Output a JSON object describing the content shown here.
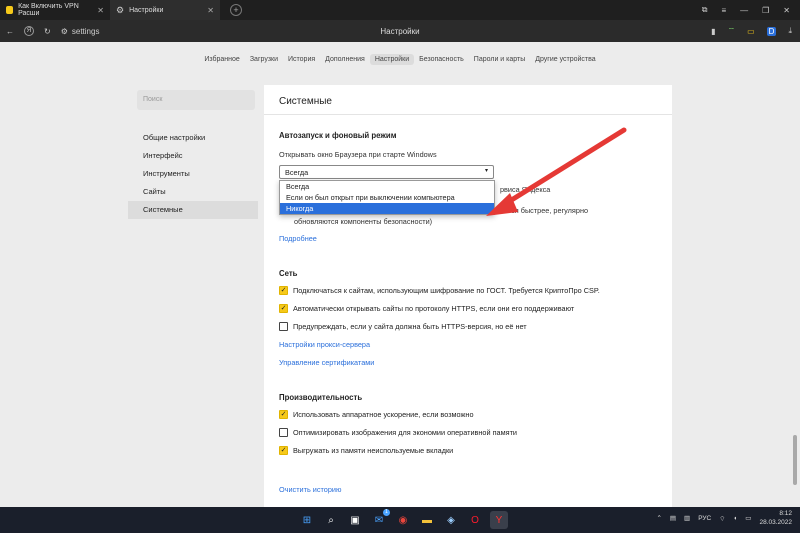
{
  "tabs": [
    {
      "title": "Как Включить VPN Расши",
      "fav_color": "#f6c91a"
    },
    {
      "title": "Настройки",
      "fav_color": "#9aa0a6"
    }
  ],
  "address": {
    "url": "settings",
    "page_title": "Настройки"
  },
  "topnav": [
    "Избранное",
    "Загрузки",
    "История",
    "Дополнения",
    "Настройки",
    "Безопасность",
    "Пароли и карты",
    "Другие устройства"
  ],
  "topnav_active": "Настройки",
  "sidebar": {
    "search_placeholder": "Поиск",
    "items": [
      "Общие настройки",
      "Интерфейс",
      "Инструменты",
      "Сайты",
      "Системные"
    ],
    "selected": "Системные"
  },
  "main": {
    "title": "Системные",
    "autostart": {
      "heading": "Автозапуск и фоновый режим",
      "open_label": "Открывать окно Браузера при старте Windows",
      "select_value": "Всегда",
      "options": [
        "Всегда",
        "Если он был открыт при выключении компьютера",
        "Никогда"
      ],
      "highlighted_option": "Никогда",
      "hidden_right_1": "рвиса Яндекса",
      "hidden_right_2": "ается быстрее, регулярно",
      "hidden_line": "обновляются компоненты безопасности)",
      "more_link": "Подробнее"
    },
    "network": {
      "heading": "Сеть",
      "options": [
        {
          "label": "Подключаться к сайтам, использующим шифрование по ГОСТ. Требуется КриптоПро CSP.",
          "checked": true
        },
        {
          "label": "Автоматически открывать сайты по протоколу HTTPS, если они его поддерживают",
          "checked": true
        },
        {
          "label": "Предупреждать, если у сайта должна быть HTTPS-версия, но её нет",
          "checked": false
        }
      ],
      "proxy_link": "Настройки прокси-сервера",
      "certs_link": "Управление сертификатами"
    },
    "performance": {
      "heading": "Производительность",
      "options": [
        {
          "label": "Использовать аппаратное ускорение, если возможно",
          "checked": true
        },
        {
          "label": "Оптимизировать изображения для экономии оперативной памяти",
          "checked": false
        },
        {
          "label": "Выгружать из памяти неиспользуемые вкладки",
          "checked": true
        }
      ]
    },
    "clear_history_link": "Очистить историю"
  },
  "taskbar": {
    "lang": "РУС",
    "time": "8:12",
    "date": "28.03.2022",
    "mail_badge": "1"
  },
  "colors": {
    "accent": "#2a6fdb",
    "checkbox": "#f6c91a",
    "arrow": "#e53935"
  }
}
